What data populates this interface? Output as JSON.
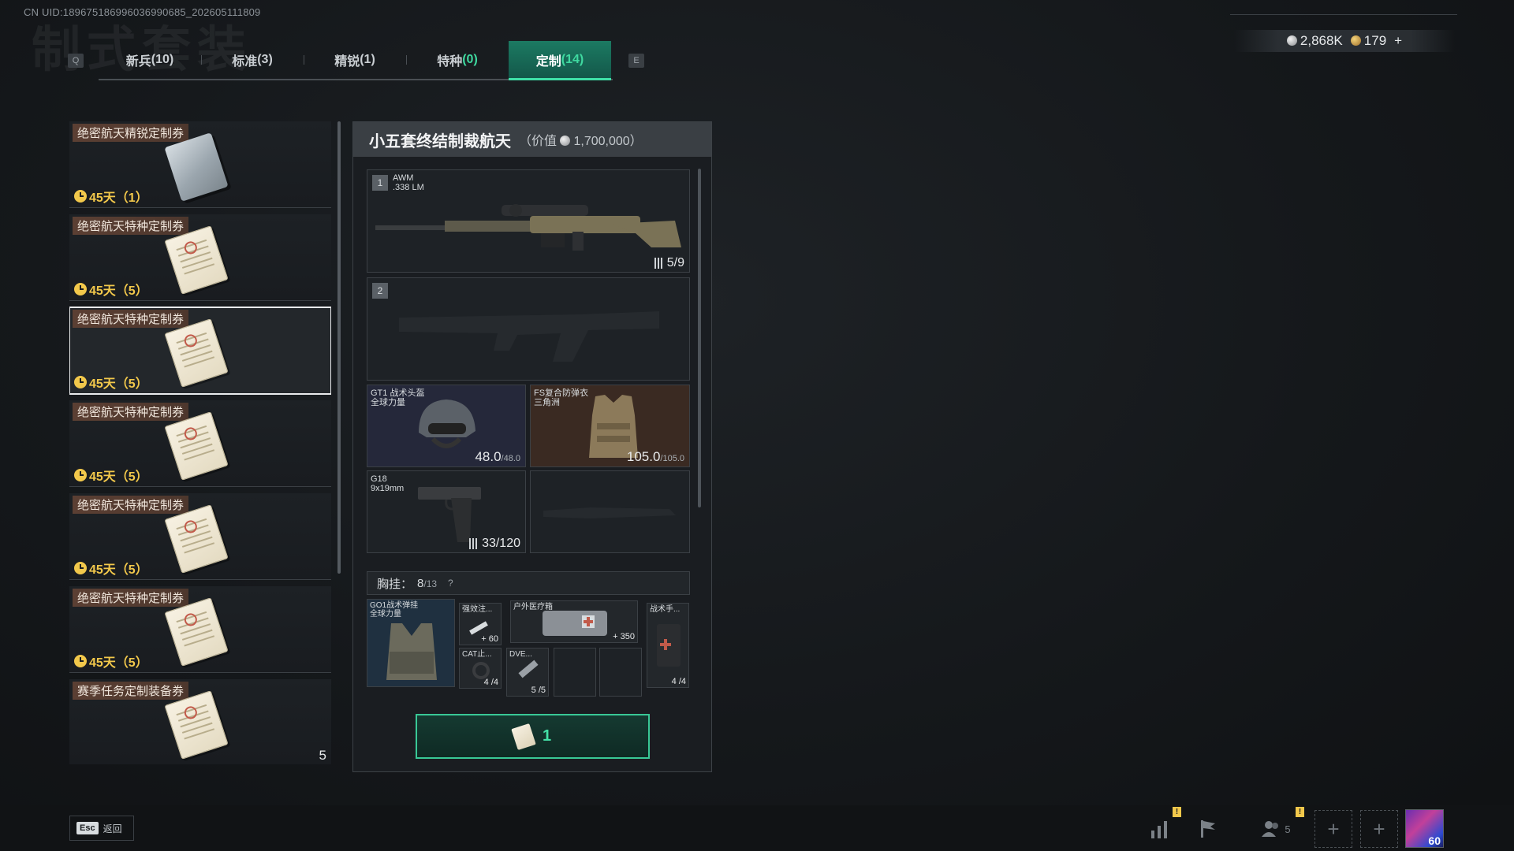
{
  "uid": "CN UID:189675186996036990685_202605111809",
  "bg_title": "制式套装",
  "tabs": {
    "prev_key": "Q",
    "next_key": "E",
    "items": [
      {
        "label": "新兵",
        "count": "(10)"
      },
      {
        "label": "标准",
        "count": "(3)"
      },
      {
        "label": "精锐",
        "count": "(1)"
      },
      {
        "label": "特种",
        "count": "(0)"
      },
      {
        "label": "定制",
        "count": "(14)"
      }
    ]
  },
  "currency": {
    "silver": "2,868K",
    "gold": "179",
    "add": "+"
  },
  "list": [
    {
      "name": "绝密航天精锐定制券",
      "time": "45天（1）",
      "icon": "silver-voucher-icon"
    },
    {
      "name": "绝密航天特种定制券",
      "time": "45天（5）",
      "icon": "paper-voucher-icon"
    },
    {
      "name": "绝密航天特种定制券",
      "time": "45天（5）",
      "icon": "paper-voucher-icon"
    },
    {
      "name": "绝密航天特种定制券",
      "time": "45天（5）",
      "icon": "paper-voucher-icon"
    },
    {
      "name": "绝密航天特种定制券",
      "time": "45天（5）",
      "icon": "paper-voucher-icon"
    },
    {
      "name": "绝密航天特种定制券",
      "time": "45天（5）",
      "icon": "paper-voucher-icon"
    },
    {
      "name": "赛季任务定制装备券",
      "qty": "5",
      "icon": "paper-voucher-icon"
    }
  ],
  "panel": {
    "title": "小五套终结制裁航天",
    "value_prefix": "（价值",
    "value": "1,700,000）",
    "slot1": {
      "num": "1",
      "name": "AWM",
      "caliber": ".338 LM",
      "ammo": "5/9"
    },
    "slot2": {
      "num": "2"
    },
    "helmet": {
      "name": "GT1 战术头盔",
      "sub": "全球力量",
      "dur": "48.0",
      "max": "/48.0"
    },
    "armor": {
      "name": "FS复合防弹衣",
      "sub": "三角洲",
      "dur": "105.0",
      "max": "/105.0"
    },
    "pistol": {
      "name": "G18",
      "caliber": "9x19mm",
      "ammo": "33/120"
    },
    "rig": {
      "label": "胸挂：",
      "used": "8",
      "cap": "/13",
      "help": "?"
    },
    "rig_item": {
      "name": "GO1战术弹挂",
      "sub": "全球力量"
    },
    "mini": [
      {
        "name": "强效注...",
        "badge": "+ 60"
      },
      {
        "name": "户外医疗箱",
        "badge": "+ 350"
      },
      {
        "name": "战术手...",
        "badge": "4 /4"
      },
      {
        "name": "CAT止...",
        "badge": "4 /4"
      },
      {
        "name": "DVE...",
        "badge": "5 /5"
      }
    ],
    "craft_count": "1"
  },
  "bottom": {
    "esc_key": "Esc",
    "esc_label": "返回",
    "friends": "5",
    "avatar_level": "60",
    "warn": "!"
  }
}
